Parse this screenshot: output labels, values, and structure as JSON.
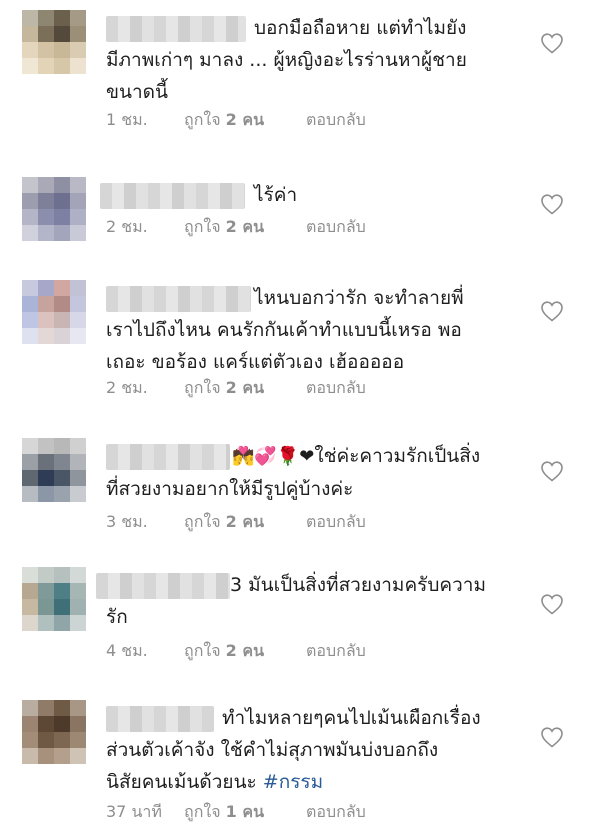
{
  "comments": [
    {
      "text_lines": [
        "บอกมือถือหาย แต่ทำไมยัง",
        "มีภาพเก่าๆ มาลง ... ผู้หญิงอะไรร่านหาผู้ชาย",
        "ขนาดนี้"
      ],
      "time": "1 ชม.",
      "likes_prefix": "ถูกใจ",
      "likes_count": "2 คน",
      "reply": "ตอบกลับ",
      "like_icon": "heart-outline-icon"
    },
    {
      "text_lines": [
        "ไร้ค่า"
      ],
      "time": "2 ชม.",
      "likes_prefix": "ถูกใจ",
      "likes_count": "2 คน",
      "reply": "ตอบกลับ",
      "like_icon": "heart-outline-icon"
    },
    {
      "text_lines": [
        "ไหนบอกว่ารัก จะทำลายพี่",
        "เราไปถึงไหน คนรักกันเค้าทำแบบนี้เหรอ พอ",
        "เถอะ ขอร้อง แคร์แต่ตัวเอง เฮ้อออออ"
      ],
      "time": "2 ชม.",
      "likes_prefix": "ถูกใจ",
      "likes_count": "2 คน",
      "reply": "ตอบกลับ",
      "like_icon": "heart-outline-icon"
    },
    {
      "emojis": "💏💞🌹❤",
      "text_lines": [
        "ใช่ค่ะคาวมรักเป็นสิ่ง",
        "ที่สวยงามอยากให้มีรูปคู่บ้างค่ะ"
      ],
      "time": "3 ชม.",
      "likes_prefix": "ถูกใจ",
      "likes_count": "2 คน",
      "reply": "ตอบกลับ",
      "like_icon": "heart-outline-icon"
    },
    {
      "text_lines": [
        "3 มันเป็นสิ่งที่สวยงามครับความ",
        "รัก"
      ],
      "time": "4 ชม.",
      "likes_prefix": "ถูกใจ",
      "likes_count": "2 คน",
      "reply": "ตอบกลับ",
      "like_icon": "heart-outline-icon"
    },
    {
      "text_lines": [
        "ทำไมหลายๆคนไปเม้นเผือกเรื่อง",
        "ส่วนตัวเค้าจัง ใช้คำไม่สุภาพมันบ่งบอกถึง",
        "นิสัยคนเม้นด้วยนะ "
      ],
      "hashtag": "#กรรม",
      "time": "37 นาที",
      "likes_prefix": "ถูกใจ",
      "likes_count": "1 คน",
      "reply": "ตอบกลับ",
      "like_icon": "heart-outline-icon"
    }
  ]
}
